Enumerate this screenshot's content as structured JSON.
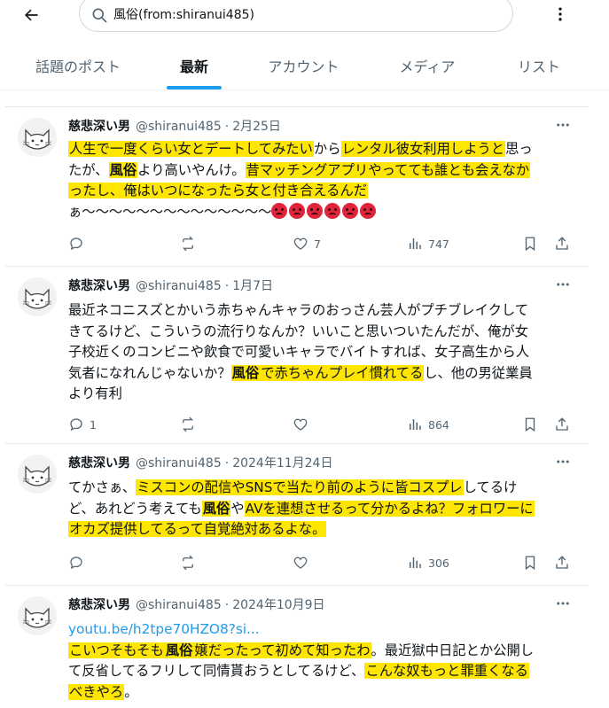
{
  "search": {
    "query": "風俗(from:shiranui485)"
  },
  "tabs": [
    {
      "label": "話題のポスト"
    },
    {
      "label": "最新",
      "active": true
    },
    {
      "label": "アカウント"
    },
    {
      "label": "メディア"
    },
    {
      "label": "リスト"
    }
  ],
  "colors": {
    "accent": "#1d9bf0",
    "highlight": "#ffe600",
    "muted": "#536471"
  },
  "tweets": [
    {
      "user_name": "慈悲深い男",
      "handle": "@shiranui485",
      "date": "2月25日",
      "replies": "",
      "likes": "7",
      "views": "747",
      "lines": [
        [
          "hl:人生で一度くらい女とデートしてみたい",
          "から",
          "hl:レンタル彼女利用しようと",
          "思っ"
        ],
        [
          "たが、",
          "hlb:風俗",
          "より高いやんけ。",
          "hl:昔マッチングアプリやってても誰とも会えなか"
        ],
        [
          "hl:ったし、俺はいつになったら女と付き合えるんだ"
        ],
        [
          "ぁ〜〜〜〜〜〜〜〜〜〜〜〜〜〜",
          "emoji:6"
        ]
      ]
    },
    {
      "user_name": "慈悲深い男",
      "handle": "@shiranui485",
      "date": "1月7日",
      "replies": "1",
      "likes": "",
      "views": "864",
      "lines": [
        [
          "最近ネコニスズとかいう赤ちゃんキャラのおっさん芸人がプチブレイクして"
        ],
        [
          "きてるけど、こういうの流行りなんか？いいこと思いついたんだが、俺が女"
        ],
        [
          "子校近くのコンビニや飲食で可愛いキャラでバイトすれば、女子高生から人"
        ],
        [
          "気者になれんじゃないか？",
          "hlb:風俗",
          "hl:で赤ちゃんプレイ慣れてる",
          "し、他の男従業員"
        ],
        [
          "より有利"
        ]
      ]
    },
    {
      "user_name": "慈悲深い男",
      "handle": "@shiranui485",
      "date": "2024年11月24日",
      "replies": "",
      "likes": "",
      "views": "306",
      "lines": [
        [
          "てかさぁ、",
          "hl:ミスコンの配信やSNSで当たり前のように皆コスプレ",
          "してるけ"
        ],
        [
          "ど、あれどう考えても",
          "hlb:風俗",
          "や",
          "hl:AVを連想させるって分かるよね？フォロワーに"
        ],
        [
          "hl:オカズ提供してるって自覚絶対あるよな。"
        ]
      ]
    },
    {
      "user_name": "慈悲深い男",
      "handle": "@shiranui485",
      "date": "2024年10月9日",
      "link": "youtu.be/h2tpe70HZO8?si...",
      "lines": [
        [
          "hl:こいつそもそも",
          "hlb:風俗",
          "hl:嬢だったって初めて知ったわ",
          "。最近獄中日記とか公開し"
        ],
        [
          "て反省してるフリして同情貰おうとしてるけど、",
          "hl:こんな奴もっと罪重くなる"
        ],
        [
          "hl:べきやろ",
          "。"
        ]
      ]
    }
  ]
}
